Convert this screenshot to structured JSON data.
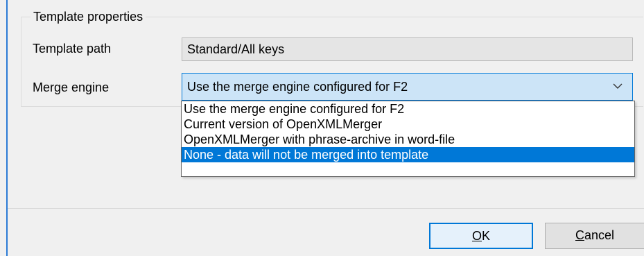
{
  "group": {
    "title": "Template properties"
  },
  "template_path": {
    "label": "Template path",
    "value": "Standard/All keys"
  },
  "merge_engine": {
    "label": "Merge engine",
    "selected": "Use the merge engine configured for F2",
    "options": [
      "Use the merge engine configured for F2",
      "Current version of OpenXMLMerger",
      "OpenXMLMerger with phrase-archive in word-file",
      "None - data will not be merged into template"
    ],
    "highlighted_index": 3
  },
  "buttons": {
    "ok": {
      "mnemonic": "O",
      "rest": "K"
    },
    "cancel": {
      "mnemonic": "C",
      "rest": "ancel"
    }
  },
  "colors": {
    "accent": "#0078d7",
    "combo_bg": "#cce4f7",
    "window_edge": "#2b7bd6"
  },
  "icons": {
    "dropdown": "chevron-down-icon"
  }
}
